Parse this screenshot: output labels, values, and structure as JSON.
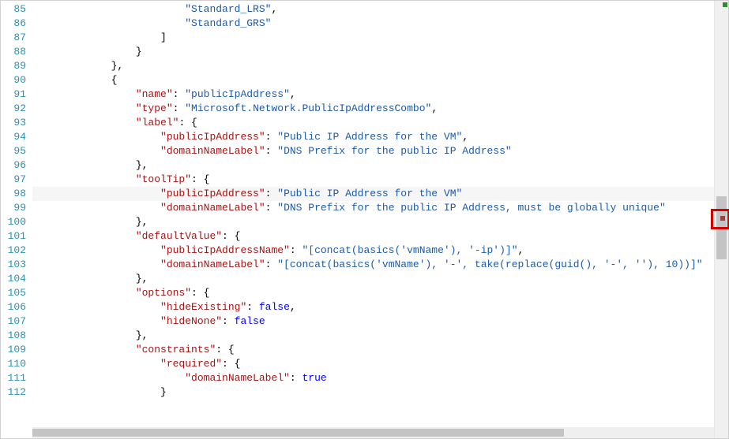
{
  "editor": {
    "active_line": 98,
    "lines": [
      {
        "num": 85,
        "indent": 6,
        "tokens": [
          {
            "t": "s",
            "v": "\"Standard_LRS\""
          },
          {
            "t": "p",
            "v": ","
          }
        ]
      },
      {
        "num": 86,
        "indent": 6,
        "tokens": [
          {
            "t": "s",
            "v": "\"Standard_GRS\""
          }
        ]
      },
      {
        "num": 87,
        "indent": 5,
        "tokens": [
          {
            "t": "p",
            "v": "]"
          }
        ]
      },
      {
        "num": 88,
        "indent": 4,
        "tokens": [
          {
            "t": "p",
            "v": "}"
          }
        ]
      },
      {
        "num": 89,
        "indent": 3,
        "tokens": [
          {
            "t": "p",
            "v": "},"
          }
        ]
      },
      {
        "num": 90,
        "indent": 3,
        "tokens": [
          {
            "t": "p",
            "v": "{"
          }
        ]
      },
      {
        "num": 91,
        "indent": 4,
        "tokens": [
          {
            "t": "k",
            "v": "\"name\""
          },
          {
            "t": "p",
            "v": ": "
          },
          {
            "t": "s",
            "v": "\"publicIpAddress\""
          },
          {
            "t": "p",
            "v": ","
          }
        ]
      },
      {
        "num": 92,
        "indent": 4,
        "tokens": [
          {
            "t": "k",
            "v": "\"type\""
          },
          {
            "t": "p",
            "v": ": "
          },
          {
            "t": "s",
            "v": "\"Microsoft.Network.PublicIpAddressCombo\""
          },
          {
            "t": "p",
            "v": ","
          }
        ]
      },
      {
        "num": 93,
        "indent": 4,
        "tokens": [
          {
            "t": "k",
            "v": "\"label\""
          },
          {
            "t": "p",
            "v": ": {"
          }
        ]
      },
      {
        "num": 94,
        "indent": 5,
        "tokens": [
          {
            "t": "k",
            "v": "\"publicIpAddress\""
          },
          {
            "t": "p",
            "v": ": "
          },
          {
            "t": "s",
            "v": "\"Public IP Address for the VM\""
          },
          {
            "t": "p",
            "v": ","
          }
        ]
      },
      {
        "num": 95,
        "indent": 5,
        "tokens": [
          {
            "t": "k",
            "v": "\"domainNameLabel\""
          },
          {
            "t": "p",
            "v": ": "
          },
          {
            "t": "s",
            "v": "\"DNS Prefix for the public IP Address\""
          }
        ]
      },
      {
        "num": 96,
        "indent": 4,
        "tokens": [
          {
            "t": "p",
            "v": "},"
          }
        ]
      },
      {
        "num": 97,
        "indent": 4,
        "tokens": [
          {
            "t": "k",
            "v": "\"toolTip\""
          },
          {
            "t": "p",
            "v": ": {"
          }
        ]
      },
      {
        "num": 98,
        "indent": 5,
        "tokens": [
          {
            "t": "k",
            "v": "\"publicIpAddress\""
          },
          {
            "t": "p",
            "v": ": "
          },
          {
            "t": "s",
            "v": "\"Public IP Address for the VM\""
          }
        ]
      },
      {
        "num": 99,
        "indent": 5,
        "tokens": [
          {
            "t": "k",
            "v": "\"domainNameLabel\"",
            "err": true
          },
          {
            "t": "p",
            "v": ": "
          },
          {
            "t": "s",
            "v": "\"DNS Prefix for the public IP Address, must be globally unique\""
          }
        ]
      },
      {
        "num": 100,
        "indent": 4,
        "tokens": [
          {
            "t": "p",
            "v": "},"
          }
        ]
      },
      {
        "num": 101,
        "indent": 4,
        "tokens": [
          {
            "t": "k",
            "v": "\"defaultValue\""
          },
          {
            "t": "p",
            "v": ": {"
          }
        ]
      },
      {
        "num": 102,
        "indent": 5,
        "tokens": [
          {
            "t": "k",
            "v": "\"publicIpAddressName\""
          },
          {
            "t": "p",
            "v": ": "
          },
          {
            "t": "s",
            "v": "\"[concat(basics('vmName'), '-ip')]\""
          },
          {
            "t": "p",
            "v": ","
          }
        ]
      },
      {
        "num": 103,
        "indent": 5,
        "tokens": [
          {
            "t": "k",
            "v": "\"domainNameLabel\""
          },
          {
            "t": "p",
            "v": ": "
          },
          {
            "t": "s",
            "v": "\"[concat(basics('vmName'), '-', take(replace(guid(), '-', ''), 10))]\""
          }
        ]
      },
      {
        "num": 104,
        "indent": 4,
        "tokens": [
          {
            "t": "p",
            "v": "},"
          }
        ]
      },
      {
        "num": 105,
        "indent": 4,
        "tokens": [
          {
            "t": "k",
            "v": "\"options\""
          },
          {
            "t": "p",
            "v": ": {"
          }
        ]
      },
      {
        "num": 106,
        "indent": 5,
        "tokens": [
          {
            "t": "k",
            "v": "\"hideExisting\""
          },
          {
            "t": "p",
            "v": ": "
          },
          {
            "t": "b",
            "v": "false"
          },
          {
            "t": "p",
            "v": ","
          }
        ]
      },
      {
        "num": 107,
        "indent": 5,
        "tokens": [
          {
            "t": "k",
            "v": "\"hideNone\""
          },
          {
            "t": "p",
            "v": ": "
          },
          {
            "t": "b",
            "v": "false"
          }
        ]
      },
      {
        "num": 108,
        "indent": 4,
        "tokens": [
          {
            "t": "p",
            "v": "},"
          }
        ]
      },
      {
        "num": 109,
        "indent": 4,
        "tokens": [
          {
            "t": "k",
            "v": "\"constraints\""
          },
          {
            "t": "p",
            "v": ": {"
          }
        ]
      },
      {
        "num": 110,
        "indent": 5,
        "tokens": [
          {
            "t": "k",
            "v": "\"required\""
          },
          {
            "t": "p",
            "v": ": {"
          }
        ]
      },
      {
        "num": 111,
        "indent": 6,
        "tokens": [
          {
            "t": "k",
            "v": "\"domainNameLabel\""
          },
          {
            "t": "p",
            "v": ": "
          },
          {
            "t": "b",
            "v": "true"
          }
        ]
      },
      {
        "num": 112,
        "indent": 5,
        "tokens": [
          {
            "t": "p",
            "v": "}"
          }
        ]
      }
    ]
  }
}
